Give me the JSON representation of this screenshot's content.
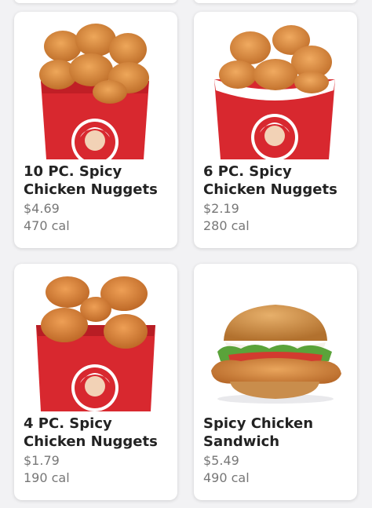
{
  "menu": {
    "items": [
      {
        "name": "10 PC. Spicy\nChicken Nuggets",
        "price": "$4.69",
        "calories": "470 cal",
        "image": "nuggets-box-large"
      },
      {
        "name": "6 PC. Spicy\nChicken Nuggets",
        "price": "$2.19",
        "calories": "280 cal",
        "image": "nuggets-box-medium"
      },
      {
        "name": "4 PC. Spicy\nChicken Nuggets",
        "price": "$1.79",
        "calories": "190 cal",
        "image": "nuggets-box-small"
      },
      {
        "name": "Spicy Chicken\nSandwich",
        "price": "$5.49",
        "calories": "490 cal",
        "image": "spicy-chicken-sandwich"
      }
    ]
  },
  "colors": {
    "box_red": "#d8282f",
    "nugget": "#d9893e",
    "bun": "#c8863d",
    "lettuce": "#5aa33a",
    "tomato": "#d23b2f"
  }
}
